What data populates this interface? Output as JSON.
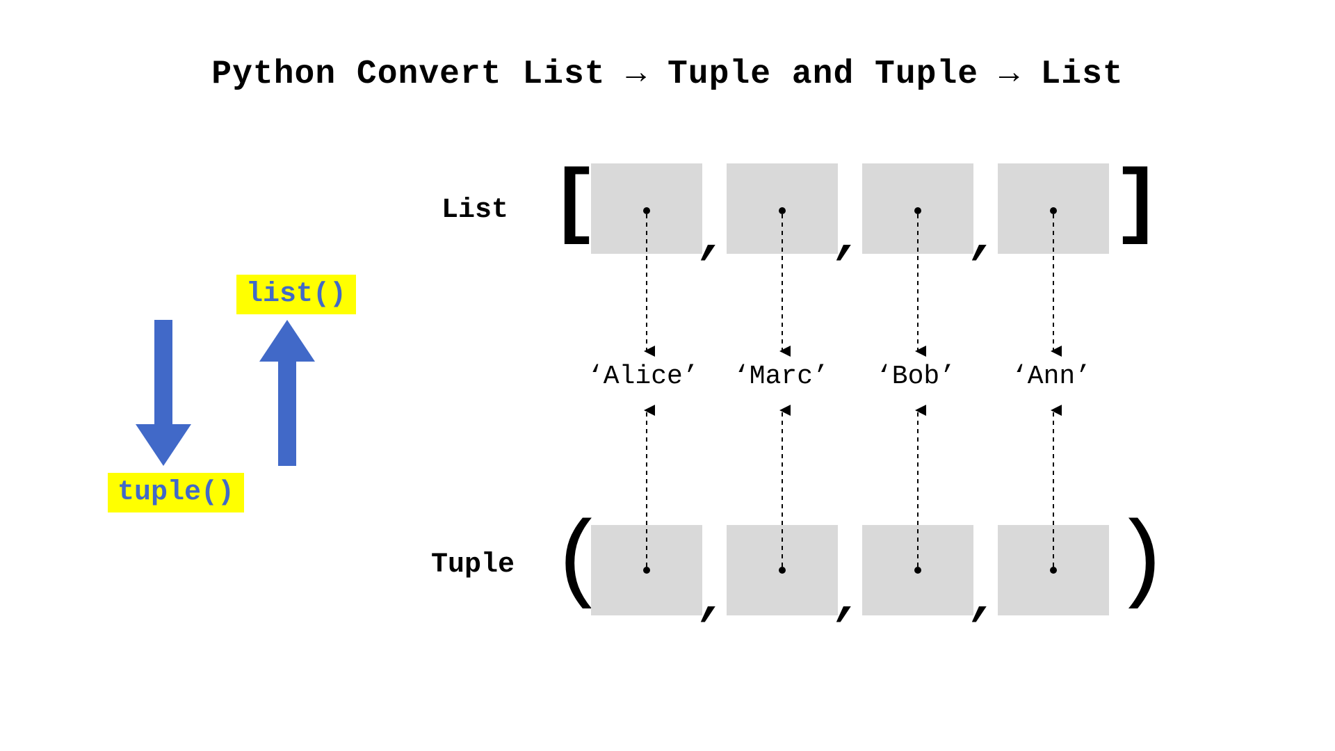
{
  "title": "Python Convert List → Tuple and Tuple → List",
  "labels": {
    "list": "List",
    "tuple": "Tuple"
  },
  "brackets": {
    "open_square": "[",
    "close_square": "]",
    "open_paren": "(",
    "close_paren": ")",
    "comma": ","
  },
  "values": {
    "v0": "‘Alice’",
    "v1": "‘Marc’",
    "v2": "‘Bob’",
    "v3": "‘Ann’"
  },
  "badges": {
    "list_fn": "list()",
    "tuple_fn": "tuple()"
  },
  "colors": {
    "arrow_blue": "#4169c8",
    "highlight": "#ffff00",
    "box_gray": "#d9d9d9"
  }
}
